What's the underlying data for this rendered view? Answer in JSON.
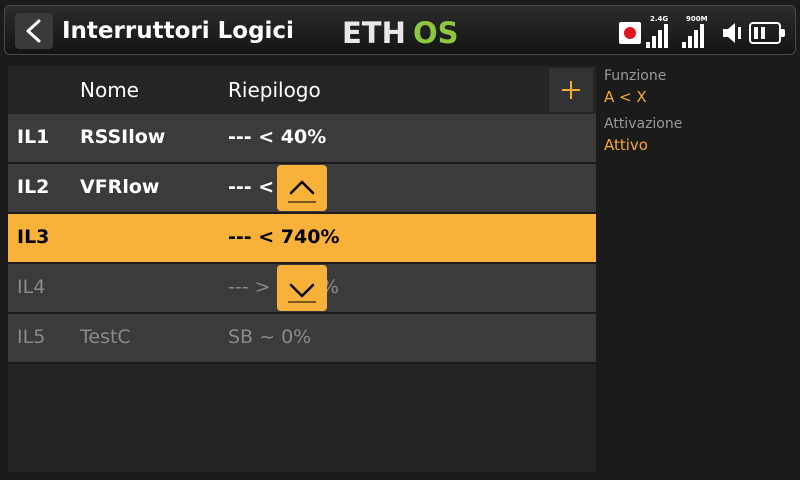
{
  "header": {
    "title": "Interruttori Logici",
    "logo": "ETHOS",
    "status": {
      "signal_1_label": "2.4G",
      "signal_2_label": "900M"
    }
  },
  "list": {
    "columns": {
      "nome": "Nome",
      "riepilogo": "Riepilogo"
    },
    "rows": [
      {
        "id": "IL1",
        "name": "RSSIlow",
        "summary": "--- < 40%",
        "state": "normal"
      },
      {
        "id": "IL2",
        "name": "VFRlow",
        "summary": "--- < 5",
        "state": "normal"
      },
      {
        "id": "IL3",
        "name": "",
        "summary": "--- < 740%",
        "state": "selected"
      },
      {
        "id": "IL4",
        "name": "",
        "summary": "--- >",
        "summary_tail": "%",
        "state": "disabled"
      },
      {
        "id": "IL5",
        "name": "TestC",
        "summary": "SB ~ 0%",
        "state": "disabled"
      }
    ]
  },
  "details": {
    "funzione_label": "Funzione",
    "funzione_value": "A < X",
    "attivazione_label": "Attivazione",
    "attivazione_value": "Attivo"
  },
  "colors": {
    "accent": "#f8b23a",
    "row_bg": "#3b3b3b",
    "panel_bg": "#232323",
    "value_text": "#f5a935",
    "logo_os": "#8dc63f"
  }
}
